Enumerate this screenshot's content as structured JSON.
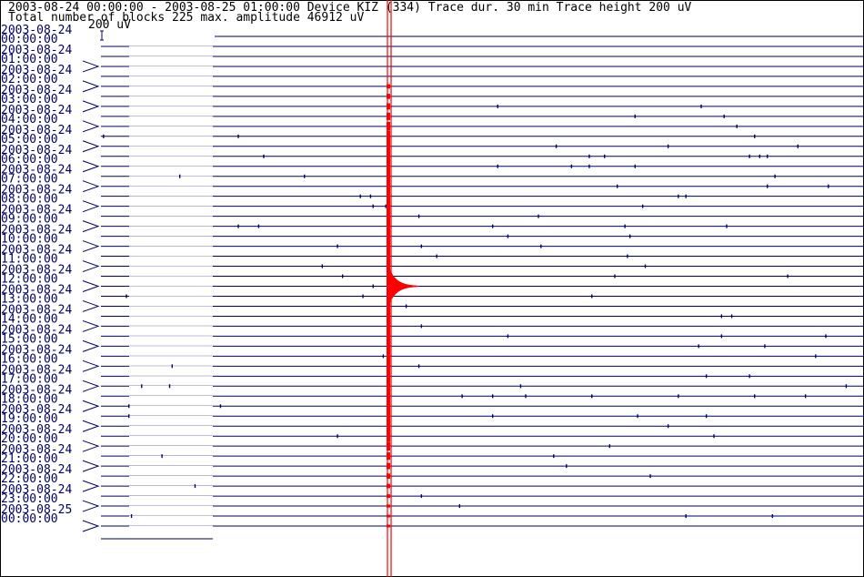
{
  "header": {
    "line1": "2003-08-24 00:00:00 - 2003-08-25 01:00:00  Device  KIZ (334)  Trace dur. 30 min  Trace height 200 uV",
    "line2": "Total number of blocks 225 max. amplitude 46912 uV",
    "scale_label": "200 uV"
  },
  "colors": {
    "trace": "#000060",
    "event": "#ff0000",
    "text": "#000000",
    "frame": "#000000"
  },
  "chart_data": {
    "type": "line",
    "trace_duration_min": 30,
    "trace_height_uV": 200,
    "total_blocks": 225,
    "max_amplitude_uV": 46912,
    "time_labels": [
      {
        "date": "2003-08-24",
        "time": "00:00:00"
      },
      {
        "date": "2003-08-24",
        "time": "01:00:00"
      },
      {
        "date": "2003-08-24",
        "time": "02:00:00"
      },
      {
        "date": "2003-08-24",
        "time": "03:00:00"
      },
      {
        "date": "2003-08-24",
        "time": "04:00:00"
      },
      {
        "date": "2003-08-24",
        "time": "05:00:00"
      },
      {
        "date": "2003-08-24",
        "time": "06:00:00"
      },
      {
        "date": "2003-08-24",
        "time": "07:00:00"
      },
      {
        "date": "2003-08-24",
        "time": "08:00:00"
      },
      {
        "date": "2003-08-24",
        "time": "09:00:00"
      },
      {
        "date": "2003-08-24",
        "time": "10:00:00"
      },
      {
        "date": "2003-08-24",
        "time": "11:00:00"
      },
      {
        "date": "2003-08-24",
        "time": "12:00:00"
      },
      {
        "date": "2003-08-24",
        "time": "13:00:00"
      },
      {
        "date": "2003-08-24",
        "time": "14:00:00"
      },
      {
        "date": "2003-08-24",
        "time": "15:00:00"
      },
      {
        "date": "2003-08-24",
        "time": "16:00:00"
      },
      {
        "date": "2003-08-24",
        "time": "17:00:00"
      },
      {
        "date": "2003-08-24",
        "time": "18:00:00"
      },
      {
        "date": "2003-08-24",
        "time": "19:00:00"
      },
      {
        "date": "2003-08-24",
        "time": "20:00:00"
      },
      {
        "date": "2003-08-24",
        "time": "21:00:00"
      },
      {
        "date": "2003-08-24",
        "time": "22:00:00"
      },
      {
        "date": "2003-08-24",
        "time": "23:00:00"
      },
      {
        "date": "2003-08-25",
        "time": "00:00:00"
      }
    ],
    "event": {
      "minute": 11.3,
      "first_trace": 5,
      "last_trace": 49,
      "peak_trace": 25,
      "coda_minutes": 1.2
    },
    "spikes": [
      [
        7,
        15.6
      ],
      [
        7,
        23.6
      ],
      [
        8,
        21.0
      ],
      [
        8,
        24.5
      ],
      [
        9,
        25.0
      ],
      [
        9,
        34.0
      ],
      [
        9,
        34.8
      ],
      [
        10,
        0.1
      ],
      [
        10,
        5.4
      ],
      [
        10,
        25.7
      ],
      [
        11,
        17.9
      ],
      [
        11,
        22.3
      ],
      [
        11,
        27.4
      ],
      [
        12,
        6.4
      ],
      [
        12,
        19.2
      ],
      [
        12,
        19.8
      ],
      [
        12,
        25.5
      ],
      [
        12,
        25.9
      ],
      [
        12,
        26.2
      ],
      [
        12,
        34.5
      ],
      [
        13,
        15.6
      ],
      [
        13,
        18.5
      ],
      [
        13,
        19.2
      ],
      [
        13,
        21.0
      ],
      [
        14,
        3.1
      ],
      [
        14,
        8.0
      ],
      [
        14,
        11.3
      ],
      [
        14,
        26.5
      ],
      [
        15,
        20.3
      ],
      [
        15,
        26.2
      ],
      [
        15,
        28.6
      ],
      [
        16,
        10.2
      ],
      [
        16,
        10.6
      ],
      [
        16,
        22.7
      ],
      [
        16,
        23.0
      ],
      [
        17,
        10.7
      ],
      [
        17,
        11.2
      ],
      [
        17,
        21.3
      ],
      [
        18,
        12.5
      ],
      [
        18,
        17.2
      ],
      [
        19,
        5.4
      ],
      [
        19,
        6.2
      ],
      [
        19,
        15.4
      ],
      [
        19,
        20.6
      ],
      [
        19,
        24.6
      ],
      [
        20,
        16.0
      ],
      [
        20,
        20.8
      ],
      [
        21,
        9.3
      ],
      [
        21,
        12.6
      ],
      [
        21,
        17.3
      ],
      [
        22,
        13.2
      ],
      [
        22,
        20.7
      ],
      [
        23,
        8.7
      ],
      [
        23,
        21.4
      ],
      [
        24,
        9.5
      ],
      [
        24,
        20.2
      ],
      [
        24,
        27.0
      ],
      [
        25,
        10.7
      ],
      [
        26,
        1.0
      ],
      [
        26,
        10.3
      ],
      [
        26,
        19.3
      ],
      [
        27,
        12.0
      ],
      [
        28,
        24.4
      ],
      [
        28,
        24.8
      ],
      [
        29,
        12.6
      ],
      [
        30,
        16.0
      ],
      [
        30,
        24.4
      ],
      [
        30,
        28.5
      ],
      [
        31,
        23.5
      ],
      [
        31,
        26.1
      ],
      [
        32,
        11.1
      ],
      [
        32,
        28.1
      ],
      [
        33,
        2.8
      ],
      [
        33,
        12.5
      ],
      [
        34,
        23.8
      ],
      [
        34,
        25.5
      ],
      [
        35,
        1.6
      ],
      [
        35,
        2.7
      ],
      [
        35,
        16.5
      ],
      [
        35,
        29.3
      ],
      [
        36,
        14.2
      ],
      [
        36,
        15.4
      ],
      [
        36,
        16.7
      ],
      [
        36,
        19.3
      ],
      [
        36,
        22.7
      ],
      [
        36,
        25.7
      ],
      [
        36,
        27.7
      ],
      [
        37,
        1.1
      ],
      [
        37,
        4.7
      ],
      [
        38,
        1.1
      ],
      [
        38,
        15.4
      ],
      [
        38,
        21.1
      ],
      [
        38,
        23.8
      ],
      [
        38,
        30.0
      ],
      [
        39,
        22.3
      ],
      [
        40,
        9.3
      ],
      [
        40,
        24.1
      ],
      [
        41,
        20.0
      ],
      [
        42,
        2.4
      ],
      [
        42,
        17.8
      ],
      [
        43,
        18.3
      ],
      [
        44,
        21.6
      ],
      [
        45,
        3.7
      ],
      [
        46,
        12.6
      ],
      [
        47,
        14.1
      ],
      [
        48,
        1.2
      ],
      [
        48,
        23.0
      ],
      [
        48,
        26.4
      ]
    ]
  }
}
